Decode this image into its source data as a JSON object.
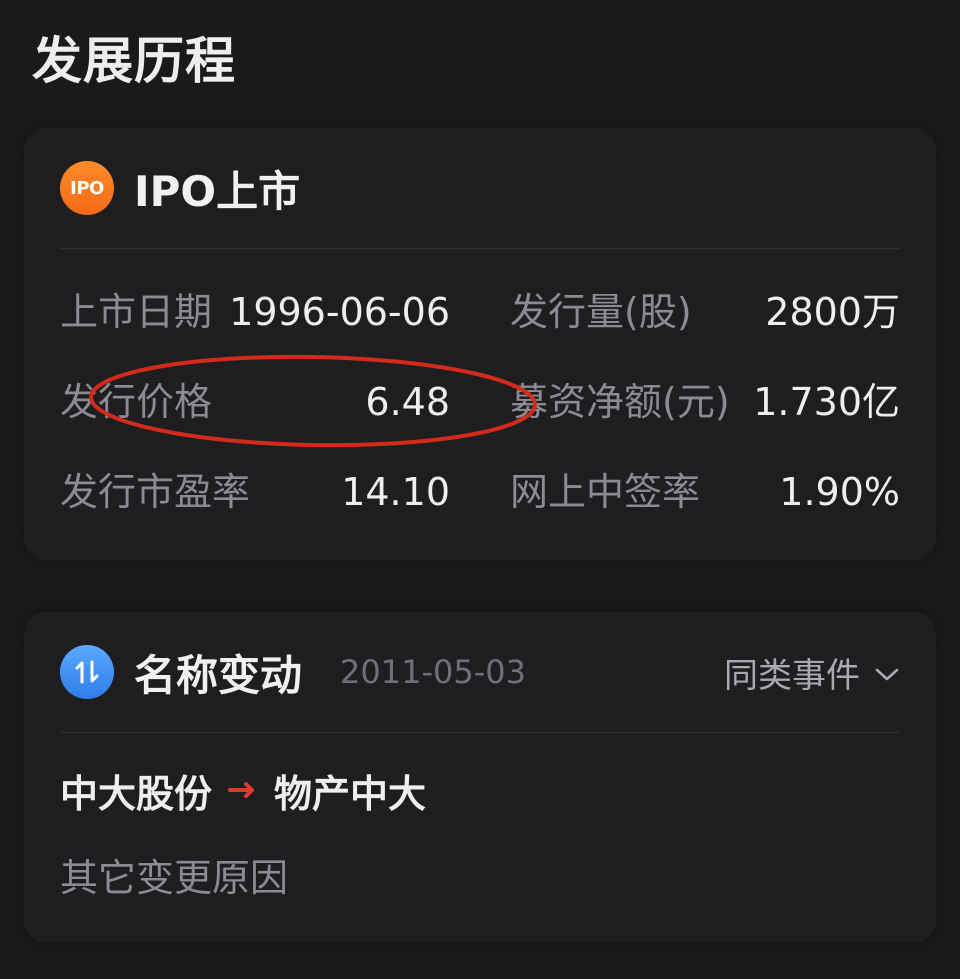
{
  "page": {
    "title": "发展历程"
  },
  "ipo": {
    "badge": "IPO",
    "title": "IPO上市",
    "rows": [
      {
        "left_label": "上市日期",
        "left_value": "1996-06-06",
        "right_label": "发行量(股)",
        "right_value": "2800万"
      },
      {
        "left_label": "发行价格",
        "left_value": "6.48",
        "right_label": "募资净额(元)",
        "right_value": "1.730亿"
      },
      {
        "left_label": "发行市盈率",
        "left_value": "14.10",
        "right_label": "网上中签率",
        "right_value": "1.90%"
      }
    ],
    "highlight_color": "#d42a1c"
  },
  "rename": {
    "title": "名称变动",
    "date": "2011-05-03",
    "similar_events": "同类事件",
    "from_name": "中大股份",
    "to_name": "物产中大",
    "reason": "其它变更原因",
    "arrow_color": "#e23a2a"
  },
  "colors": {
    "background": "#1a1a1d",
    "card": "#1e1e21",
    "ipo_badge": "#f46a14",
    "rename_badge": "#2f7de8"
  }
}
